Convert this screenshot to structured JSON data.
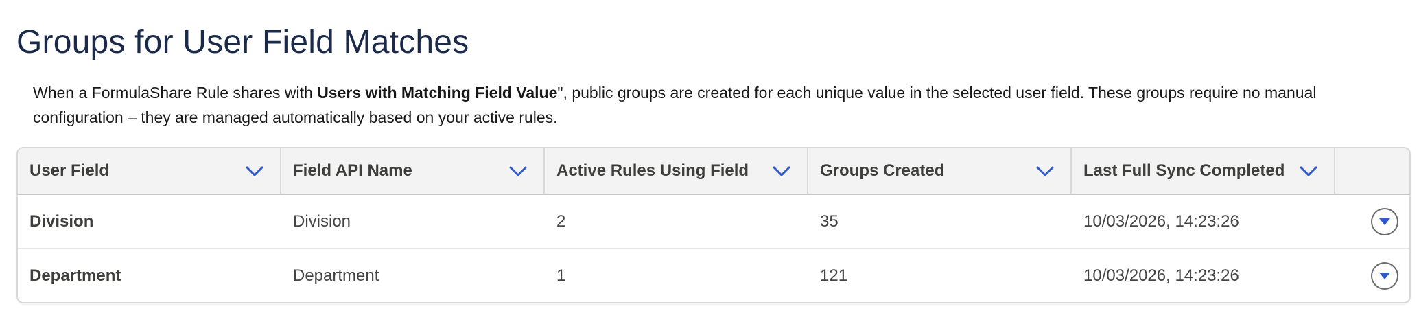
{
  "page": {
    "title": "Groups for User Field Matches",
    "description": {
      "part1": "When a FormulaShare Rule shares with ",
      "bold": "Users with Matching Field Value",
      "part2": "\", public groups are created for each unique value in the selected user field. These groups require no manual configuration – they are managed automatically based on your active rules."
    }
  },
  "table": {
    "columns": [
      "User Field",
      "Field API Name",
      "Active Rules Using Field",
      "Groups Created",
      "Last Full Sync Completed"
    ],
    "rows": [
      {
        "user_field": "Division",
        "api_name": "Division",
        "active_rules": "2",
        "groups_created": "35",
        "last_sync": "10/03/2026, 14:23:26"
      },
      {
        "user_field": "Department",
        "api_name": "Department",
        "active_rules": "1",
        "groups_created": "121",
        "last_sync": "10/03/2026, 14:23:26"
      }
    ],
    "icons": {
      "sort": "chevron-down-icon",
      "row_action": "row-action-menu-icon"
    }
  },
  "colors": {
    "title": "#1b2a49",
    "chevron": "#2d5bcf",
    "header_bg": "#f3f3f3",
    "row_action_arrow": "#2d5bcf"
  }
}
